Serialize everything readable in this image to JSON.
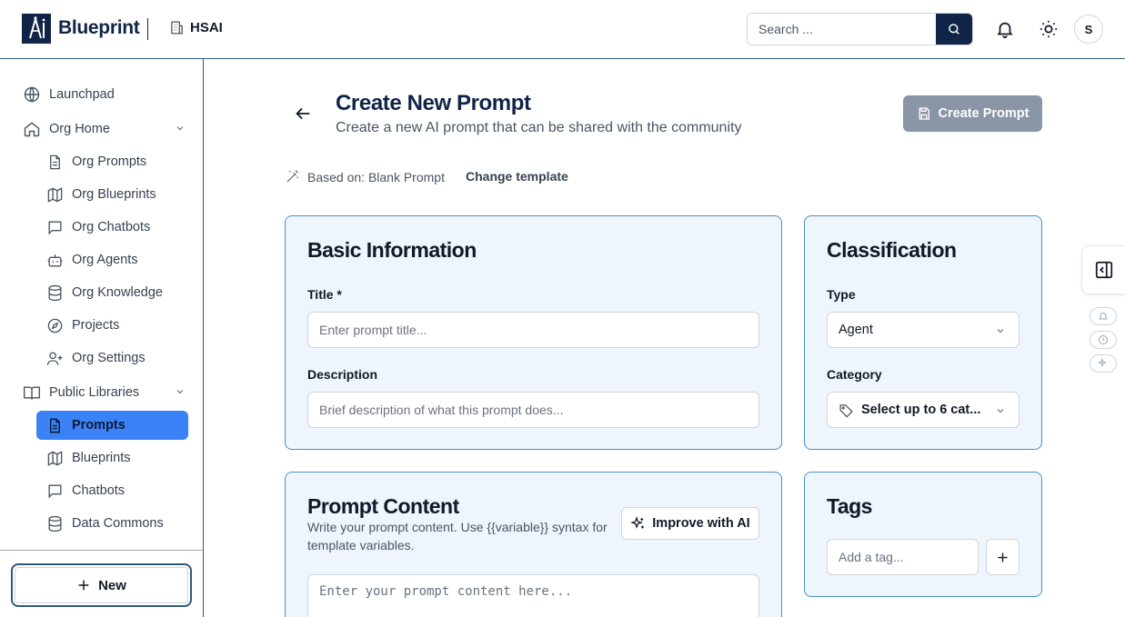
{
  "brand": {
    "name": "Blueprint",
    "org": "HSAI"
  },
  "header": {
    "search_placeholder": "Search ...",
    "avatar_initial": "S"
  },
  "sidebar": {
    "items": [
      {
        "label": "Launchpad",
        "icon": "globe-icon"
      },
      {
        "label": "Org Home",
        "icon": "home-icon"
      },
      {
        "label": "Org Prompts",
        "icon": "document-icon"
      },
      {
        "label": "Org Blueprints",
        "icon": "map-icon"
      },
      {
        "label": "Org Chatbots",
        "icon": "chat-icon"
      },
      {
        "label": "Org Agents",
        "icon": "bot-icon"
      },
      {
        "label": "Org Knowledge",
        "icon": "database-icon"
      },
      {
        "label": "Projects",
        "icon": "compass-icon"
      },
      {
        "label": "Org Settings",
        "icon": "user-plus-icon"
      },
      {
        "label": "Public Libraries",
        "icon": "book-icon"
      },
      {
        "label": "Prompts",
        "icon": "document-icon"
      },
      {
        "label": "Blueprints",
        "icon": "map-icon"
      },
      {
        "label": "Chatbots",
        "icon": "chat-icon"
      },
      {
        "label": "Data Commons",
        "icon": "database-icon"
      }
    ],
    "new_label": "New"
  },
  "page": {
    "title": "Create New Prompt",
    "subtitle": "Create a new AI prompt that can be shared with the community",
    "create_label": "Create Prompt",
    "based_on": "Based on: Blank Prompt",
    "change_template": "Change template"
  },
  "basic": {
    "title": "Basic Information",
    "title_label": "Title *",
    "title_placeholder": "Enter prompt title...",
    "desc_label": "Description",
    "desc_placeholder": "Brief description of what this prompt does..."
  },
  "classification": {
    "title": "Classification",
    "type_label": "Type",
    "type_value": "Agent",
    "category_label": "Category",
    "category_value": "Select up to 6 cat..."
  },
  "content": {
    "title": "Prompt Content",
    "hint": "Write your prompt content. Use {{variable}} syntax for template variables.",
    "improve_label": "Improve with AI",
    "placeholder": "Enter your prompt content here..."
  },
  "tags": {
    "title": "Tags",
    "placeholder": "Add a tag..."
  },
  "colors": {
    "navy": "#0f2446",
    "accent": "#3b82f6",
    "card_bg": "#eef5fc",
    "card_border": "#4a90c8",
    "button_disabled": "#8a95a5"
  }
}
